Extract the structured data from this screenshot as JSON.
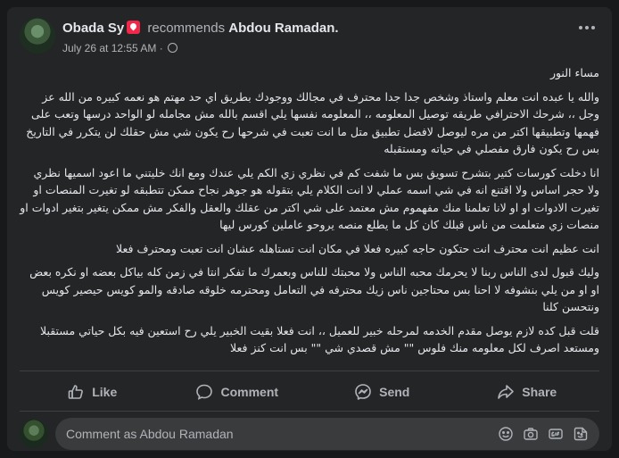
{
  "post": {
    "author": "Obada Sy",
    "action": "recommends",
    "page": "Abdou Ramadan.",
    "date": "July 26 at 12:55 AM",
    "separator": "·",
    "paragraphs": [
      "مساء النور",
      "والله يا عبده انت معلم واستاذ وشخص جدا جدا محترف في مجالك ووجودك بطريق اي حد مهتم هو نعمه كبيره من الله عز وجل ،، شرحك الاحترافي طريقه توصيل المعلومه ،، المعلومه نفسها يلي اقسم بالله مش مجامله لو الواحد درسها وتعب على فهمها وتطبيقها اكتر من مره ليوصل لافضل تطبيق متل ما انت تعبت في شرحها رح يكون شي مش حقلك لن يتكرر في التاريخ بس رح يكون فارق مفصلي في حياته ومستقبله",
      "انا دخلت كورسات كتير بتشرح تسويق بس ما شفت كم في نظري زي الكم يلي عندك ومع انك خليتني ما اعود اسميها نظري ولا حجر اساس ولا اقتنع انه في شي اسمه عملي لا انت الكلام يلي بتقوله هو جوهر نجاح ممكن تتطبقه لو تغيرت المنصات او تغيرت الادوات او او لانا تعلمنا منك مفهموم مش معتمد على شي اكتر من عقلك والعقل والفكر مش ممكن يتغير بتغير ادوات او منصات زي متعلمت من ناس قبلك كان كل ما يطلع منصه يروحو عاملين كورس ليها",
      "انت عظيم انت محترف انت حتكون حاجه كبيره فعلا في مكان انت تستاهله عشان انت تعبت ومحترف فعلا",
      "وليك قبول لدى الناس ربنا لا يحرمك محبه الناس ولا محبتك للناس وبعمرك ما تفكر انتا في زمن كله بياكل بعضه او نكره بعض او او من يلي بنشوفه لا احنا بس محتاجين ناس زيك محترفه في التعامل ومحترمه خلوقه صادقه والمو كويس حيصير كويس ونتحسن كلنا",
      "قلت قبل كده لازم يوصل مقدم الخدمه لمرحله خبير للعميل ،، انت فعلا بقيت الخبير يلي رح استعين فيه بكل حياتي مستقبلا ومستعد اصرف لكل معلومه منك فلوس \"\" مش قصدي شي \"\" بس انت كنز فعلا"
    ]
  },
  "actions": [
    {
      "label": "Like",
      "icon": "thumbs-up-icon"
    },
    {
      "label": "Comment",
      "icon": "comment-icon"
    },
    {
      "label": "Send",
      "icon": "messenger-icon"
    },
    {
      "label": "Share",
      "icon": "share-icon"
    }
  ],
  "comment": {
    "placeholder": "Comment as Abdou Ramadan",
    "icons": [
      "emoji-icon",
      "camera-icon",
      "gif-icon",
      "sticker-icon"
    ]
  },
  "colors": {
    "card": "#242526",
    "background": "#18191a",
    "text": "#e4e6eb",
    "secondary": "#b0b3b8",
    "badge": "#f02849"
  }
}
